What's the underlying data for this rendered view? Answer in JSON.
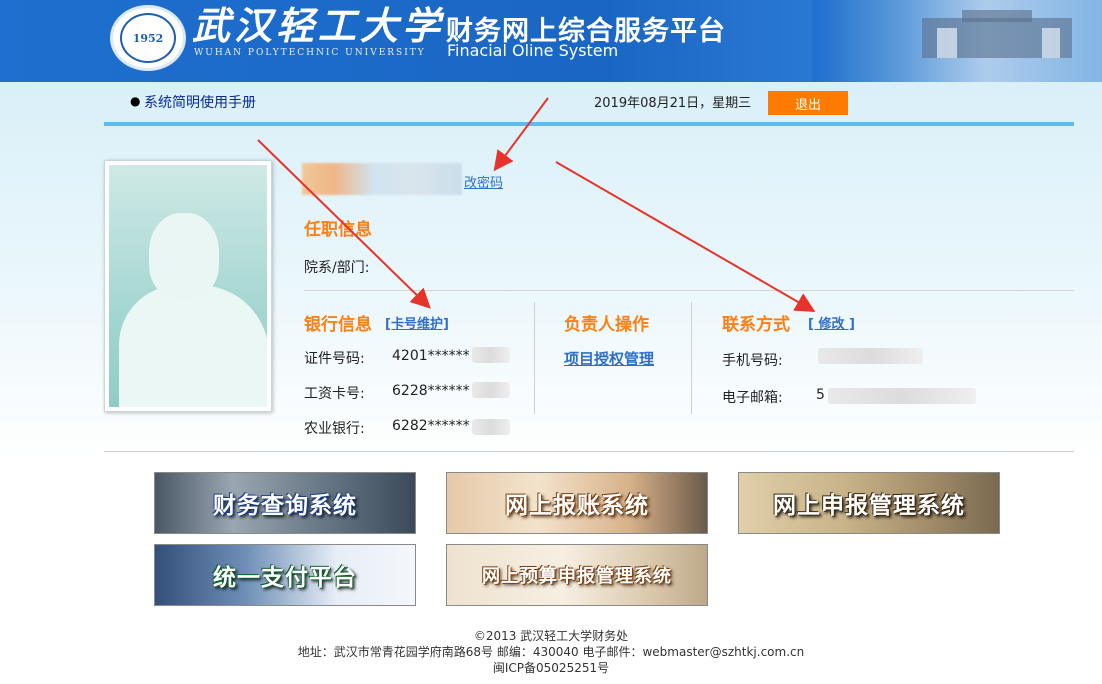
{
  "header": {
    "logo_seal_text": "1952",
    "logo_text": "武汉轻工大学",
    "logo_subtitle": "WUHAN POLYTECHNIC UNIVERSITY",
    "title": "财务网上综合服务平台",
    "subtitle": "Finacial Oline System"
  },
  "nav": {
    "manual_link": "系统简明使用手册",
    "date_text": "2019年08月21日，星期三",
    "logout_label": "退出"
  },
  "profile": {
    "change_password_link": "改密码"
  },
  "employment": {
    "title": "任职信息",
    "dept_label": "院系/部门:"
  },
  "bank": {
    "title": "银行信息",
    "maintain_link": "[卡号维护]",
    "rows": [
      {
        "label": "证件号码:",
        "value": "4201******"
      },
      {
        "label": "工资卡号:",
        "value": "6228******"
      },
      {
        "label": "农业银行:",
        "value": "6282******"
      }
    ]
  },
  "manager": {
    "title": "负责人操作",
    "project_link": "项目授权管理"
  },
  "contact": {
    "title": "联系方式",
    "edit_link": "[ 修改 ]",
    "phone_label": "手机号码:",
    "email_label": "电子邮箱:",
    "email_prefix": "5"
  },
  "tiles": [
    {
      "label": "财务查询系统"
    },
    {
      "label": "网上报账系统"
    },
    {
      "label": "网上申报管理系统"
    },
    {
      "label": "统一支付平台"
    },
    {
      "label": "网上预算申报管理系统"
    }
  ],
  "footer": {
    "copyright": "©2013 武汉轻工大学财务处",
    "address": "地址：武汉市常青花园学府南路68号 邮编：430040 电子邮件：webmaster@szhtkj.com.cn",
    "icp": "闽ICP备05025251号"
  },
  "colors": {
    "header_bg": "#1e6fcf",
    "accent_orange": "#ff7f12",
    "link_blue": "#2f6fce",
    "nav_line": "#5bbcf2",
    "annotation_red": "#e8332a"
  }
}
